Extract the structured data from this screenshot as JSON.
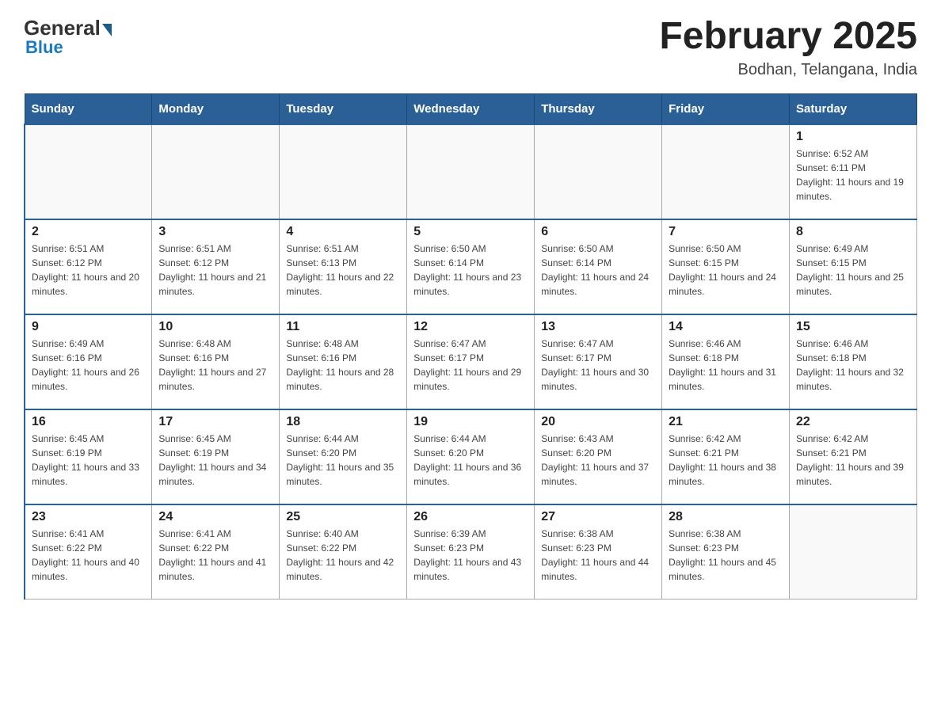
{
  "header": {
    "logo_general": "General",
    "logo_blue": "Blue",
    "main_title": "February 2025",
    "subtitle": "Bodhan, Telangana, India"
  },
  "days_of_week": [
    "Sunday",
    "Monday",
    "Tuesday",
    "Wednesday",
    "Thursday",
    "Friday",
    "Saturday"
  ],
  "weeks": [
    [
      {
        "day": "",
        "sunrise": "",
        "sunset": "",
        "daylight": ""
      },
      {
        "day": "",
        "sunrise": "",
        "sunset": "",
        "daylight": ""
      },
      {
        "day": "",
        "sunrise": "",
        "sunset": "",
        "daylight": ""
      },
      {
        "day": "",
        "sunrise": "",
        "sunset": "",
        "daylight": ""
      },
      {
        "day": "",
        "sunrise": "",
        "sunset": "",
        "daylight": ""
      },
      {
        "day": "",
        "sunrise": "",
        "sunset": "",
        "daylight": ""
      },
      {
        "day": "1",
        "sunrise": "Sunrise: 6:52 AM",
        "sunset": "Sunset: 6:11 PM",
        "daylight": "Daylight: 11 hours and 19 minutes."
      }
    ],
    [
      {
        "day": "2",
        "sunrise": "Sunrise: 6:51 AM",
        "sunset": "Sunset: 6:12 PM",
        "daylight": "Daylight: 11 hours and 20 minutes."
      },
      {
        "day": "3",
        "sunrise": "Sunrise: 6:51 AM",
        "sunset": "Sunset: 6:12 PM",
        "daylight": "Daylight: 11 hours and 21 minutes."
      },
      {
        "day": "4",
        "sunrise": "Sunrise: 6:51 AM",
        "sunset": "Sunset: 6:13 PM",
        "daylight": "Daylight: 11 hours and 22 minutes."
      },
      {
        "day": "5",
        "sunrise": "Sunrise: 6:50 AM",
        "sunset": "Sunset: 6:14 PM",
        "daylight": "Daylight: 11 hours and 23 minutes."
      },
      {
        "day": "6",
        "sunrise": "Sunrise: 6:50 AM",
        "sunset": "Sunset: 6:14 PM",
        "daylight": "Daylight: 11 hours and 24 minutes."
      },
      {
        "day": "7",
        "sunrise": "Sunrise: 6:50 AM",
        "sunset": "Sunset: 6:15 PM",
        "daylight": "Daylight: 11 hours and 24 minutes."
      },
      {
        "day": "8",
        "sunrise": "Sunrise: 6:49 AM",
        "sunset": "Sunset: 6:15 PM",
        "daylight": "Daylight: 11 hours and 25 minutes."
      }
    ],
    [
      {
        "day": "9",
        "sunrise": "Sunrise: 6:49 AM",
        "sunset": "Sunset: 6:16 PM",
        "daylight": "Daylight: 11 hours and 26 minutes."
      },
      {
        "day": "10",
        "sunrise": "Sunrise: 6:48 AM",
        "sunset": "Sunset: 6:16 PM",
        "daylight": "Daylight: 11 hours and 27 minutes."
      },
      {
        "day": "11",
        "sunrise": "Sunrise: 6:48 AM",
        "sunset": "Sunset: 6:16 PM",
        "daylight": "Daylight: 11 hours and 28 minutes."
      },
      {
        "day": "12",
        "sunrise": "Sunrise: 6:47 AM",
        "sunset": "Sunset: 6:17 PM",
        "daylight": "Daylight: 11 hours and 29 minutes."
      },
      {
        "day": "13",
        "sunrise": "Sunrise: 6:47 AM",
        "sunset": "Sunset: 6:17 PM",
        "daylight": "Daylight: 11 hours and 30 minutes."
      },
      {
        "day": "14",
        "sunrise": "Sunrise: 6:46 AM",
        "sunset": "Sunset: 6:18 PM",
        "daylight": "Daylight: 11 hours and 31 minutes."
      },
      {
        "day": "15",
        "sunrise": "Sunrise: 6:46 AM",
        "sunset": "Sunset: 6:18 PM",
        "daylight": "Daylight: 11 hours and 32 minutes."
      }
    ],
    [
      {
        "day": "16",
        "sunrise": "Sunrise: 6:45 AM",
        "sunset": "Sunset: 6:19 PM",
        "daylight": "Daylight: 11 hours and 33 minutes."
      },
      {
        "day": "17",
        "sunrise": "Sunrise: 6:45 AM",
        "sunset": "Sunset: 6:19 PM",
        "daylight": "Daylight: 11 hours and 34 minutes."
      },
      {
        "day": "18",
        "sunrise": "Sunrise: 6:44 AM",
        "sunset": "Sunset: 6:20 PM",
        "daylight": "Daylight: 11 hours and 35 minutes."
      },
      {
        "day": "19",
        "sunrise": "Sunrise: 6:44 AM",
        "sunset": "Sunset: 6:20 PM",
        "daylight": "Daylight: 11 hours and 36 minutes."
      },
      {
        "day": "20",
        "sunrise": "Sunrise: 6:43 AM",
        "sunset": "Sunset: 6:20 PM",
        "daylight": "Daylight: 11 hours and 37 minutes."
      },
      {
        "day": "21",
        "sunrise": "Sunrise: 6:42 AM",
        "sunset": "Sunset: 6:21 PM",
        "daylight": "Daylight: 11 hours and 38 minutes."
      },
      {
        "day": "22",
        "sunrise": "Sunrise: 6:42 AM",
        "sunset": "Sunset: 6:21 PM",
        "daylight": "Daylight: 11 hours and 39 minutes."
      }
    ],
    [
      {
        "day": "23",
        "sunrise": "Sunrise: 6:41 AM",
        "sunset": "Sunset: 6:22 PM",
        "daylight": "Daylight: 11 hours and 40 minutes."
      },
      {
        "day": "24",
        "sunrise": "Sunrise: 6:41 AM",
        "sunset": "Sunset: 6:22 PM",
        "daylight": "Daylight: 11 hours and 41 minutes."
      },
      {
        "day": "25",
        "sunrise": "Sunrise: 6:40 AM",
        "sunset": "Sunset: 6:22 PM",
        "daylight": "Daylight: 11 hours and 42 minutes."
      },
      {
        "day": "26",
        "sunrise": "Sunrise: 6:39 AM",
        "sunset": "Sunset: 6:23 PM",
        "daylight": "Daylight: 11 hours and 43 minutes."
      },
      {
        "day": "27",
        "sunrise": "Sunrise: 6:38 AM",
        "sunset": "Sunset: 6:23 PM",
        "daylight": "Daylight: 11 hours and 44 minutes."
      },
      {
        "day": "28",
        "sunrise": "Sunrise: 6:38 AM",
        "sunset": "Sunset: 6:23 PM",
        "daylight": "Daylight: 11 hours and 45 minutes."
      },
      {
        "day": "",
        "sunrise": "",
        "sunset": "",
        "daylight": ""
      }
    ]
  ]
}
